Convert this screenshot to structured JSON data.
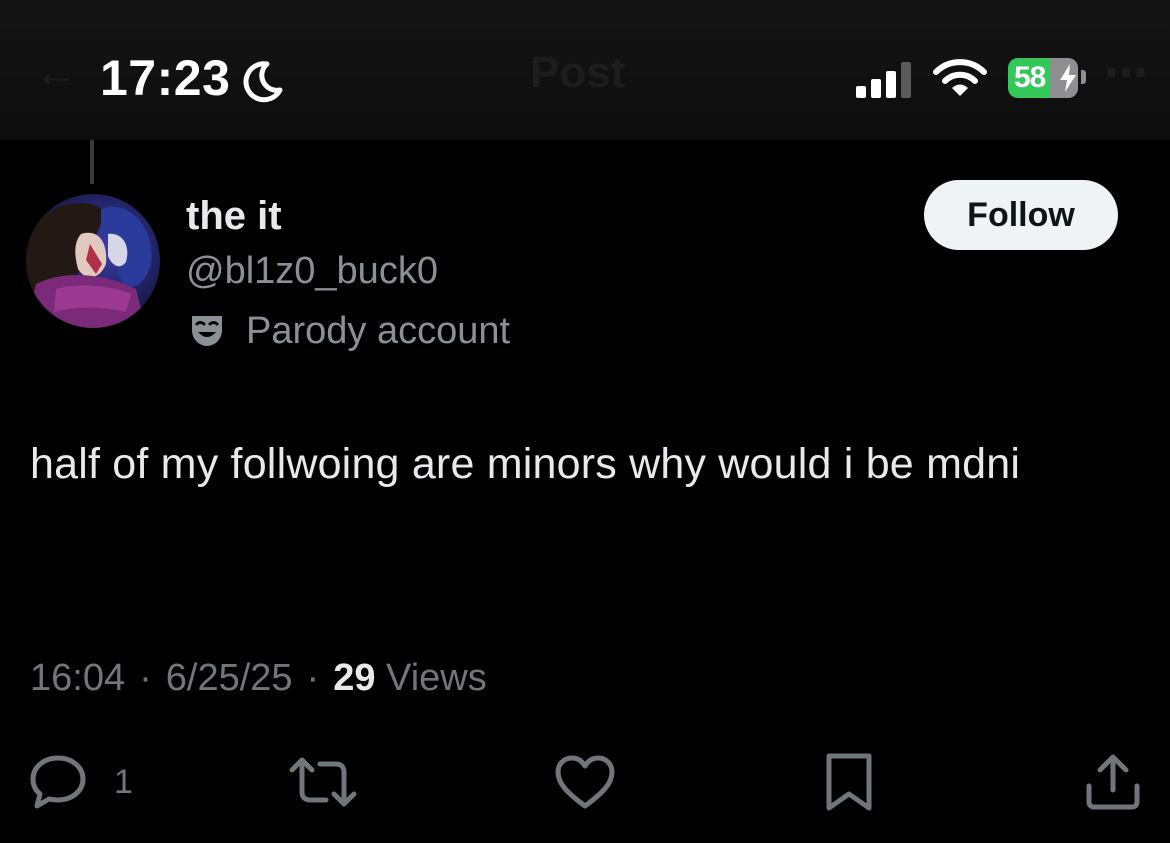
{
  "status_bar": {
    "time": "17:23",
    "battery_level": "58",
    "icons": [
      "moon-icon",
      "signal-icon",
      "wifi-icon",
      "battery-icon",
      "charging-bolt-icon"
    ]
  },
  "nav": {
    "title": "Post",
    "icons": [
      "back-arrow-icon",
      "more-options-icon"
    ]
  },
  "author": {
    "display_name": "the it",
    "handle": "@bl1z0_buck0",
    "label": "Parody account",
    "label_icon": "theater-mask-icon",
    "follow_label": "Follow"
  },
  "post": {
    "text": "half of my follwoing are minors why would i be mdni"
  },
  "meta": {
    "time": "16:04",
    "date": "6/25/25",
    "separator": "·",
    "views_count": "29",
    "views_label": "Views"
  },
  "actions": {
    "reply_count": "1",
    "icons": [
      "reply-icon",
      "repost-icon",
      "like-icon",
      "bookmark-icon",
      "share-icon"
    ]
  },
  "colors": {
    "background": "#000000",
    "primary_text": "#e7e9ea",
    "secondary_text": "#71767b",
    "follow_button_bg": "#eff3f4",
    "battery_green": "#34c759"
  }
}
